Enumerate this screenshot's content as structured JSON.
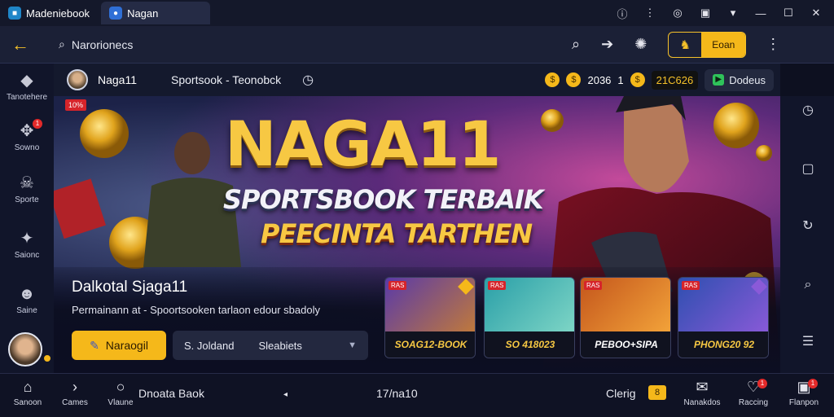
{
  "titlebar": {
    "tabs": [
      {
        "label": "Madeniebook",
        "icon": "box-logo-icon"
      },
      {
        "label": "Nagan",
        "icon": "app-logo-icon"
      }
    ],
    "controls": [
      "info-icon",
      "bars-icon",
      "gamepad-icon",
      "keyboard-icon",
      "wifi-icon",
      "minimize-icon",
      "maximize-icon",
      "close-icon"
    ]
  },
  "toolbar": {
    "search_text": "Narorionecs",
    "yellow_button_label": "Eoan"
  },
  "sidebar": {
    "items": [
      {
        "label": "Tanotehere",
        "icon": "card-icon"
      },
      {
        "label": "Sowno",
        "icon": "gamepad-icon",
        "badge": "1"
      },
      {
        "label": "Sporte",
        "icon": "skull-icon"
      },
      {
        "label": "Saionc",
        "icon": "controller-icon"
      },
      {
        "label": "Saine",
        "icon": "ghost-icon"
      }
    ]
  },
  "account": {
    "name": "Naga11",
    "tab": "Sportsook - Teonobck",
    "coins_a": "2036",
    "coins_b": "1",
    "balance": "21C626",
    "green_label": "Dodeus"
  },
  "hero": {
    "tag": "10%",
    "title": "NAGA11",
    "subtitle": "SPORTSBOOK TERBAIK",
    "tagline": "PEECINTA TARTHEN",
    "heading": "Dalkotal Sjaga11",
    "description": "Permainann at - Spoortsooken tarlaon edour sbadoly",
    "primary_button": "Naraogil",
    "select": {
      "left": "S. Joldand",
      "right": "Sleabiets"
    }
  },
  "cards": [
    {
      "tag": "RAS",
      "label": "SOAG12-BOOK",
      "colors": [
        "#5a3aa8",
        "#c17a3a"
      ]
    },
    {
      "tag": "RAS",
      "label": "SO 418023",
      "colors": [
        "#2a9fa8",
        "#7fd6c6"
      ]
    },
    {
      "tag": "RAS",
      "label": "PEBOO+SIPA",
      "colors": [
        "#c4561c",
        "#f3a43a"
      ]
    },
    {
      "tag": "RAS",
      "label": "PHONG20 92",
      "colors": [
        "#2e4fb0",
        "#8a5ad8"
      ]
    }
  ],
  "bottom": {
    "home": "Sanoon",
    "next": "Cames",
    "circle": "Vlaune",
    "middle": "Dnoata Baok",
    "counter": "17/na10",
    "clerig": "Clerig",
    "clerig_badge": "8",
    "items": [
      {
        "label": "Nanakdos",
        "icon": "chat-icon"
      },
      {
        "label": "Raccing",
        "icon": "heart-icon",
        "badge": "1"
      },
      {
        "label": "Flanpon",
        "icon": "trophy-icon",
        "badge": "1"
      }
    ]
  }
}
